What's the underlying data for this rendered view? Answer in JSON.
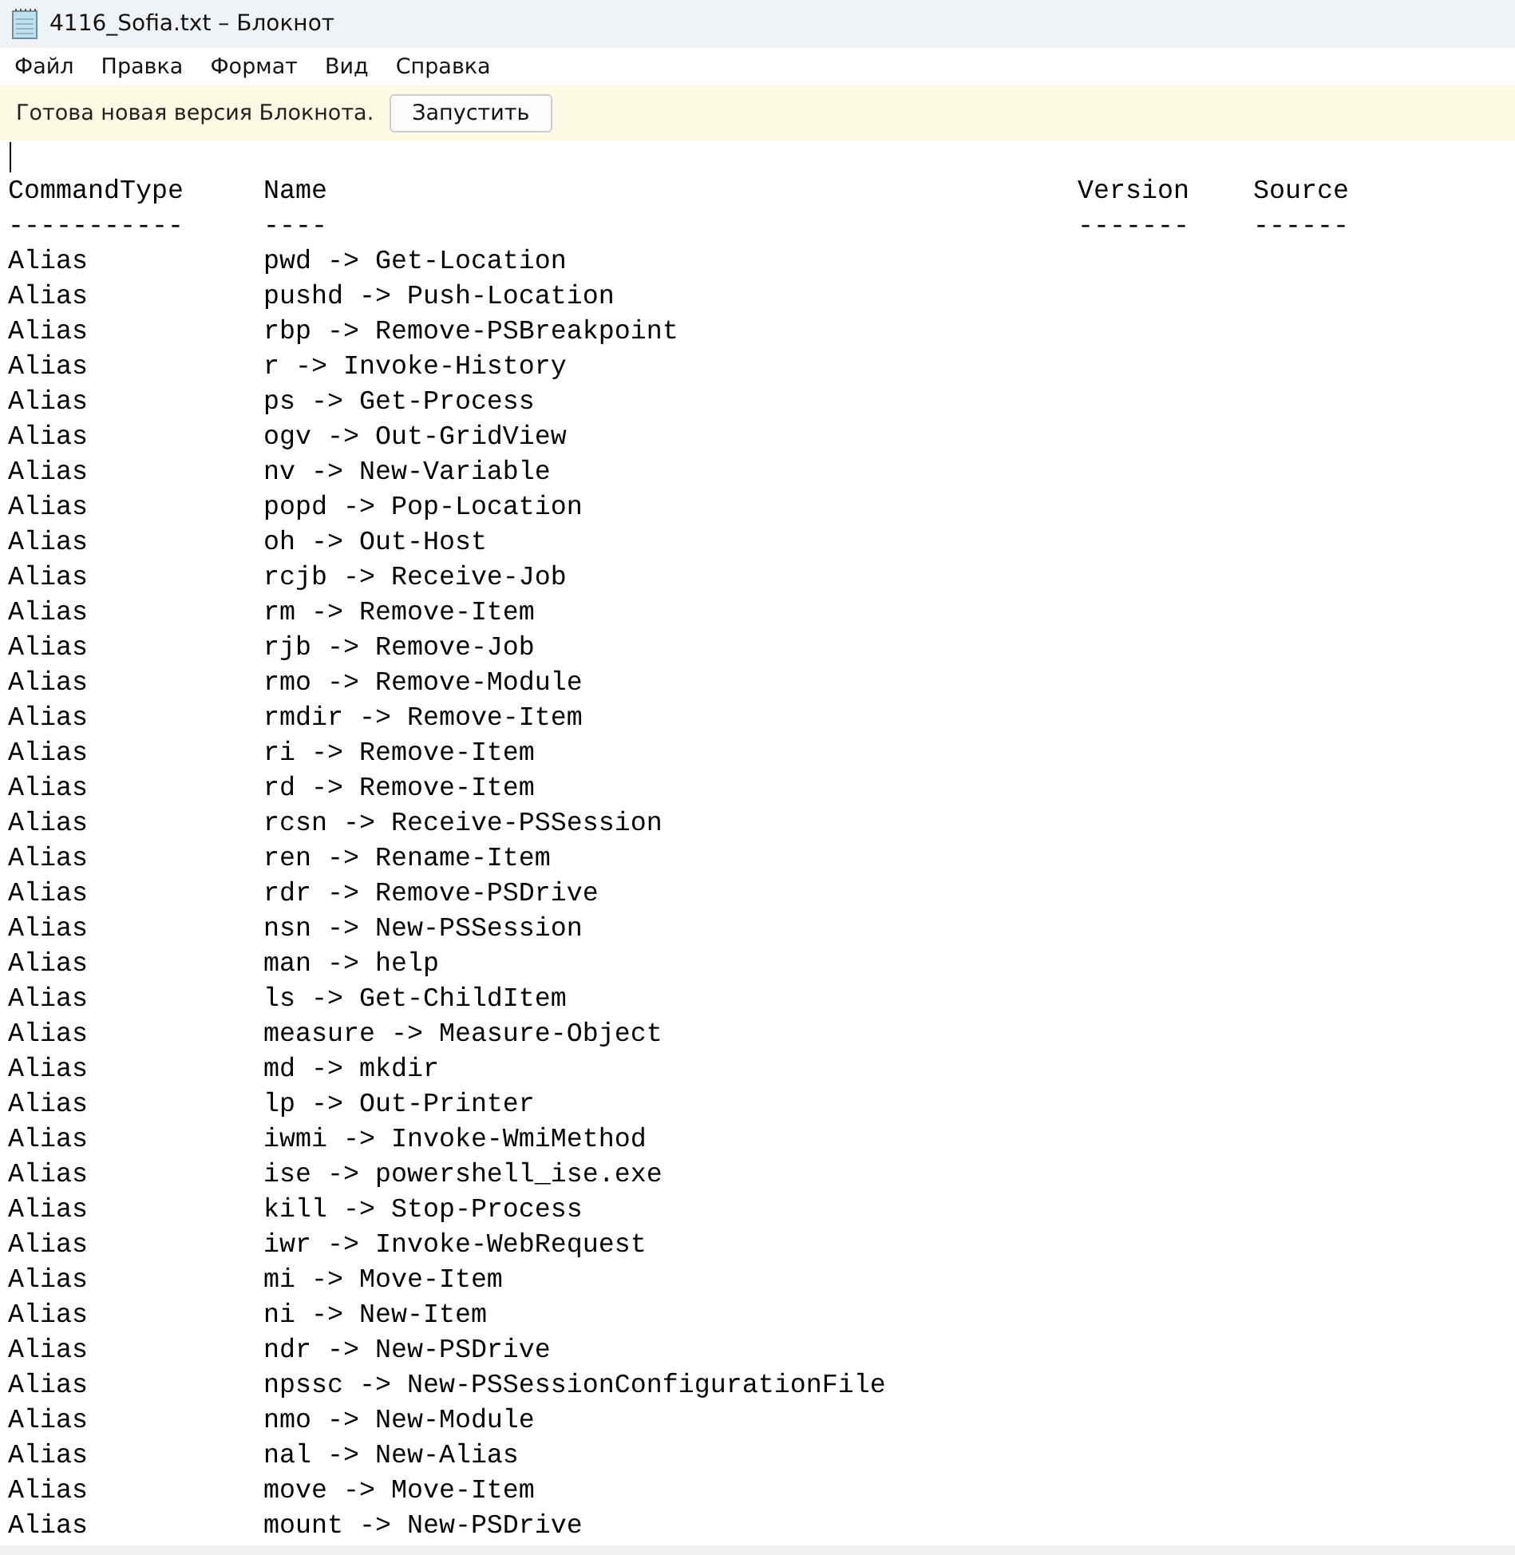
{
  "window": {
    "title": "4116_Sofia.txt – Блокнот"
  },
  "menu": [
    "Файл",
    "Правка",
    "Формат",
    "Вид",
    "Справка"
  ],
  "notification": {
    "message": "Готова новая версия Блокнота.",
    "button": "Запустить"
  },
  "document": {
    "columns": [
      "CommandType",
      "Name",
      "Version",
      "Source"
    ],
    "separators": [
      "-----------",
      "----",
      "-------",
      "------"
    ],
    "rows": [
      {
        "command_type": "Alias",
        "name": "pwd -> Get-Location"
      },
      {
        "command_type": "Alias",
        "name": "pushd -> Push-Location"
      },
      {
        "command_type": "Alias",
        "name": "rbp -> Remove-PSBreakpoint"
      },
      {
        "command_type": "Alias",
        "name": "r -> Invoke-History"
      },
      {
        "command_type": "Alias",
        "name": "ps -> Get-Process"
      },
      {
        "command_type": "Alias",
        "name": "ogv -> Out-GridView"
      },
      {
        "command_type": "Alias",
        "name": "nv -> New-Variable"
      },
      {
        "command_type": "Alias",
        "name": "popd -> Pop-Location"
      },
      {
        "command_type": "Alias",
        "name": "oh -> Out-Host"
      },
      {
        "command_type": "Alias",
        "name": "rcjb -> Receive-Job"
      },
      {
        "command_type": "Alias",
        "name": "rm -> Remove-Item"
      },
      {
        "command_type": "Alias",
        "name": "rjb -> Remove-Job"
      },
      {
        "command_type": "Alias",
        "name": "rmo -> Remove-Module"
      },
      {
        "command_type": "Alias",
        "name": "rmdir -> Remove-Item"
      },
      {
        "command_type": "Alias",
        "name": "ri -> Remove-Item"
      },
      {
        "command_type": "Alias",
        "name": "rd -> Remove-Item"
      },
      {
        "command_type": "Alias",
        "name": "rcsn -> Receive-PSSession"
      },
      {
        "command_type": "Alias",
        "name": "ren -> Rename-Item"
      },
      {
        "command_type": "Alias",
        "name": "rdr -> Remove-PSDrive"
      },
      {
        "command_type": "Alias",
        "name": "nsn -> New-PSSession"
      },
      {
        "command_type": "Alias",
        "name": "man -> help"
      },
      {
        "command_type": "Alias",
        "name": "ls -> Get-ChildItem"
      },
      {
        "command_type": "Alias",
        "name": "measure -> Measure-Object"
      },
      {
        "command_type": "Alias",
        "name": "md -> mkdir"
      },
      {
        "command_type": "Alias",
        "name": "lp -> Out-Printer"
      },
      {
        "command_type": "Alias",
        "name": "iwmi -> Invoke-WmiMethod"
      },
      {
        "command_type": "Alias",
        "name": "ise -> powershell_ise.exe"
      },
      {
        "command_type": "Alias",
        "name": "kill -> Stop-Process"
      },
      {
        "command_type": "Alias",
        "name": "iwr -> Invoke-WebRequest"
      },
      {
        "command_type": "Alias",
        "name": "mi -> Move-Item"
      },
      {
        "command_type": "Alias",
        "name": "ni -> New-Item"
      },
      {
        "command_type": "Alias",
        "name": "ndr -> New-PSDrive"
      },
      {
        "command_type": "Alias",
        "name": "npssc -> New-PSSessionConfigurationFile"
      },
      {
        "command_type": "Alias",
        "name": "nmo -> New-Module"
      },
      {
        "command_type": "Alias",
        "name": "nal -> New-Alias"
      },
      {
        "command_type": "Alias",
        "name": "move -> Move-Item"
      },
      {
        "command_type": "Alias",
        "name": "mount -> New-PSDrive"
      }
    ]
  }
}
